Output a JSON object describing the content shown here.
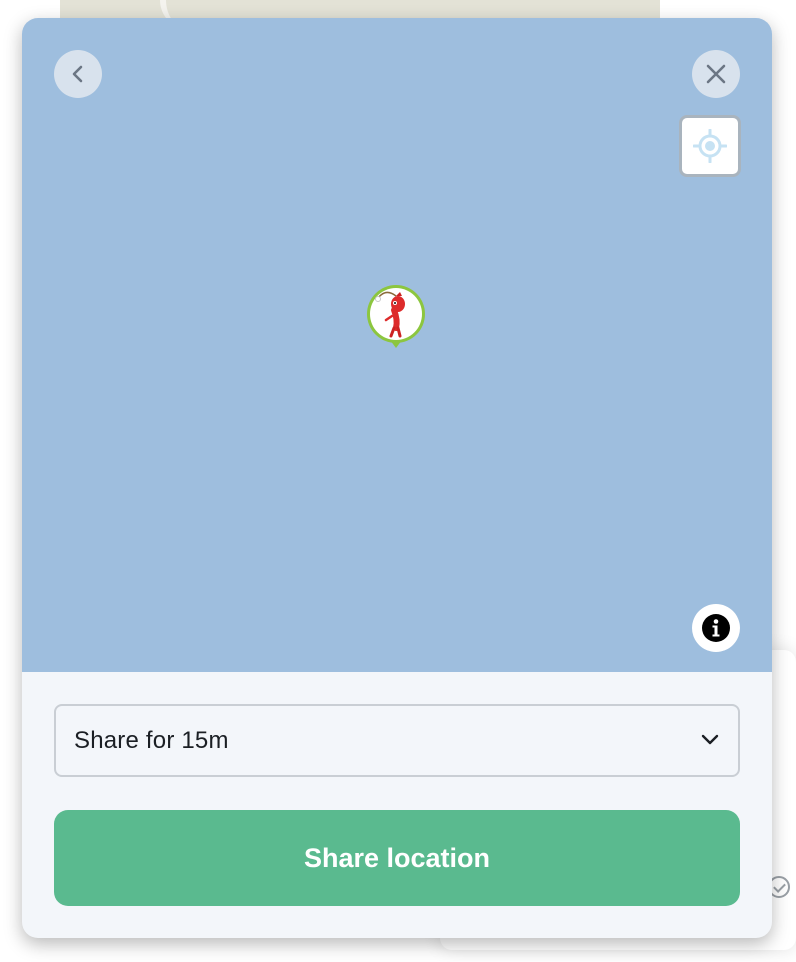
{
  "modal": {
    "duration_select": {
      "selected": "Share for 15m"
    },
    "share_button_label": "Share location",
    "map": {
      "background_color": "#9ebede",
      "marker_icon": "user-avatar-pin-icon",
      "marker_ring_color": "#8cc63f"
    },
    "icons": {
      "back": "chevron-left-icon",
      "close": "close-icon",
      "locate": "crosshair-icon",
      "info": "info-icon",
      "select_arrow": "chevron-down-icon"
    },
    "colors": {
      "primary_button": "#5aba8f",
      "panel_background": "#f3f6fa"
    }
  }
}
